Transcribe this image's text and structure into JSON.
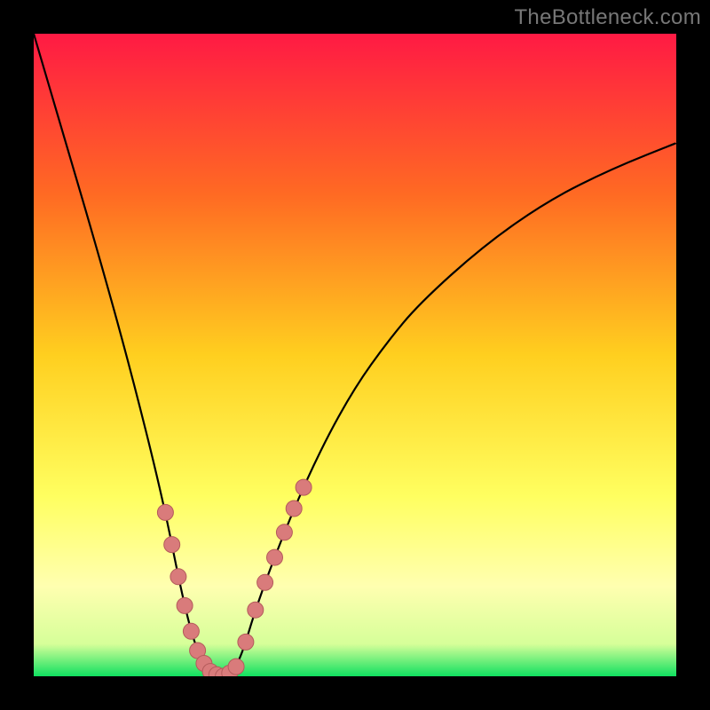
{
  "attribution": "TheBottleneck.com",
  "colors": {
    "gradient_stops": [
      {
        "offset": "0%",
        "color": "#ff1a44"
      },
      {
        "offset": "25%",
        "color": "#ff6a23"
      },
      {
        "offset": "50%",
        "color": "#ffcf1f"
      },
      {
        "offset": "72%",
        "color": "#ffff60"
      },
      {
        "offset": "86%",
        "color": "#ffffb0"
      },
      {
        "offset": "95%",
        "color": "#d6ff99"
      },
      {
        "offset": "100%",
        "color": "#10e060"
      }
    ],
    "curve": "#000000",
    "marker_fill": "#d97b7b",
    "marker_stroke": "#b45b5b",
    "frame_background": "#000000"
  },
  "chart_data": {
    "type": "line",
    "title": "",
    "xlabel": "",
    "ylabel": "",
    "x": [
      0.0,
      0.05,
      0.1,
      0.15,
      0.2,
      0.23,
      0.25,
      0.27,
      0.29,
      0.3,
      0.32,
      0.35,
      0.4,
      0.45,
      0.5,
      0.55,
      0.6,
      0.7,
      0.8,
      0.9,
      1.0
    ],
    "values": [
      100,
      83,
      66,
      48,
      28,
      13,
      5,
      1,
      0,
      0,
      2,
      12,
      25,
      36,
      45,
      52,
      58,
      67,
      74,
      79,
      83
    ],
    "xlim": [
      0,
      1
    ],
    "ylim": [
      0,
      100
    ],
    "optimum_x": 0.295,
    "markers_x": [
      0.205,
      0.215,
      0.225,
      0.235,
      0.245,
      0.255,
      0.265,
      0.275,
      0.285,
      0.295,
      0.305,
      0.315,
      0.33,
      0.345,
      0.36,
      0.375,
      0.39,
      0.405,
      0.42
    ],
    "marker_radius": 9
  }
}
